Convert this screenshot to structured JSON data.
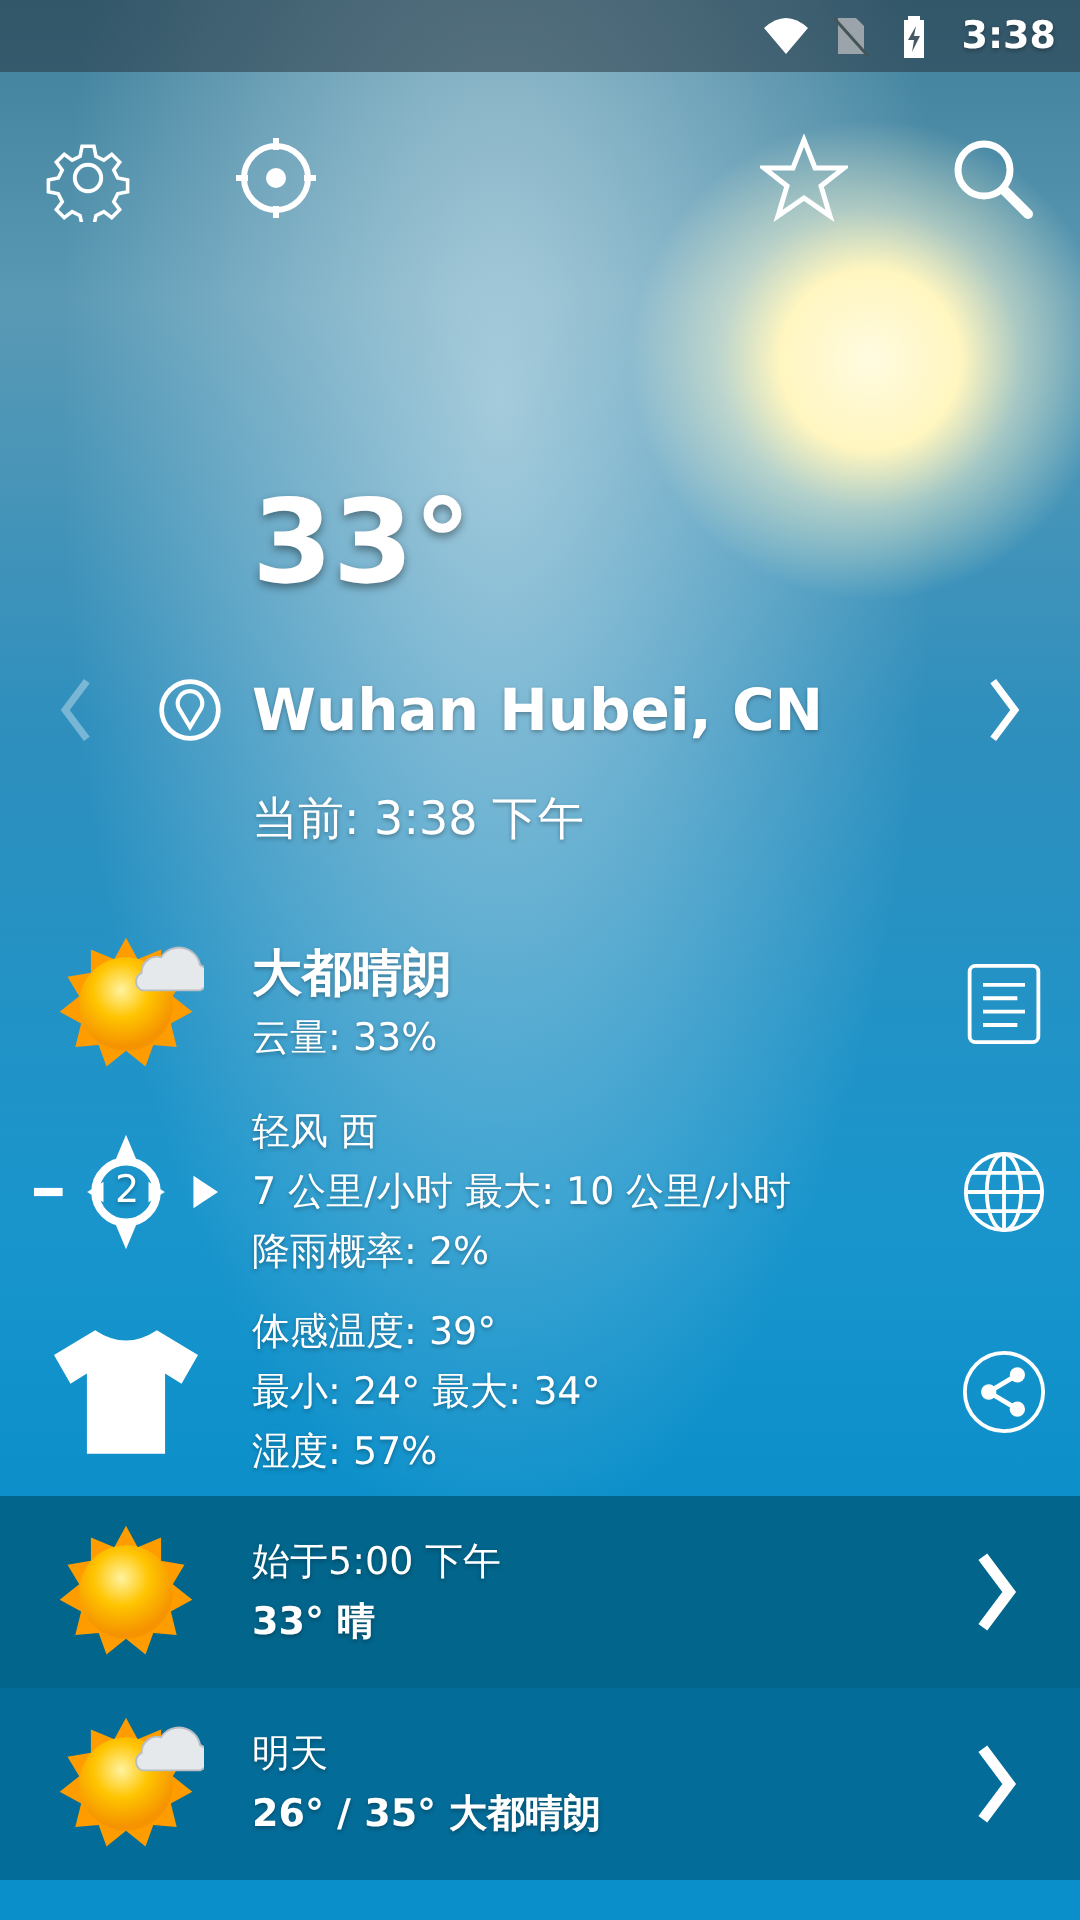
{
  "status_bar": {
    "time": "3:38"
  },
  "current": {
    "temperature": "33°",
    "location": "Wuhan Hubei, CN",
    "updated": "当前: 3:38 下午"
  },
  "details": [
    {
      "kind": "condition",
      "lines": [
        "大都晴朗",
        "云量: 33%"
      ]
    },
    {
      "kind": "wind",
      "badge": "2",
      "lines": [
        "轻风 西",
        "7 公里/小时 最大: 10 公里/小时",
        "降雨概率: 2%"
      ]
    },
    {
      "kind": "feels",
      "lines": [
        "体感温度: 39°",
        "最小: 24° 最大: 34°",
        "湿度: 57%"
      ]
    }
  ],
  "forecast": [
    {
      "kind": "sunny",
      "title": "始于5:00 下午",
      "summary": "33° 晴"
    },
    {
      "kind": "partly_cloudy",
      "title": "明天",
      "summary": "26° / 35° 大都晴朗"
    }
  ]
}
